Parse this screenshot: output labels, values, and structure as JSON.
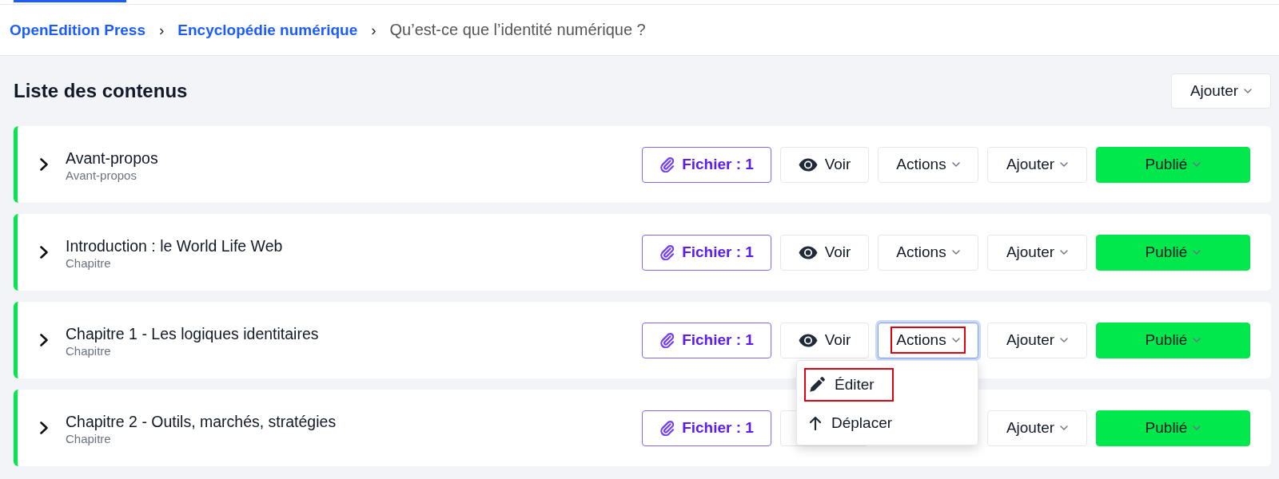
{
  "top_nav": {
    "tabs": [
      {
        "selected": true
      }
    ]
  },
  "breadcrumb": [
    {
      "kind": "link",
      "label": "OpenEdition Press"
    },
    {
      "kind": "separator",
      "label": "›"
    },
    {
      "kind": "link",
      "label": "Encyclopédie numérique"
    },
    {
      "kind": "separator",
      "label": "›"
    },
    {
      "kind": "current",
      "label": "Qu’est-ce que l’identité numérique ?"
    }
  ],
  "header": {
    "title": "Liste des contenus",
    "add_button": {
      "label": "Ajouter",
      "open": false
    }
  },
  "rows": [
    {
      "title": "Avant-propos",
      "subtitle": "Avant-propos",
      "expanded": false,
      "buttons": [
        {
          "kind": "file",
          "label": "Fichier : 1",
          "highlighted": false
        },
        {
          "kind": "view",
          "label": "Voir",
          "highlighted": false
        },
        {
          "kind": "actions",
          "label": "Actions",
          "open": false,
          "highlighted": false
        },
        {
          "kind": "add",
          "label": "Ajouter",
          "open": false,
          "highlighted": false
        },
        {
          "kind": "status",
          "label": "Publié",
          "open": false,
          "highlighted": false,
          "color": "#00e84c"
        }
      ]
    },
    {
      "title": "Introduction : le World Life Web",
      "subtitle": "Chapitre",
      "expanded": false,
      "buttons": [
        {
          "kind": "file",
          "label": "Fichier : 1",
          "highlighted": false
        },
        {
          "kind": "view",
          "label": "Voir",
          "highlighted": false
        },
        {
          "kind": "actions",
          "label": "Actions",
          "open": false,
          "highlighted": false
        },
        {
          "kind": "add",
          "label": "Ajouter",
          "open": false,
          "highlighted": false
        },
        {
          "kind": "status",
          "label": "Publié",
          "open": false,
          "highlighted": false,
          "color": "#00e84c"
        }
      ]
    },
    {
      "title": "Chapitre 1 - Les logiques identitaires",
      "subtitle": "Chapitre",
      "expanded": false,
      "buttons": [
        {
          "kind": "file",
          "label": "Fichier : 1",
          "highlighted": false
        },
        {
          "kind": "view",
          "label": "Voir",
          "highlighted": false
        },
        {
          "kind": "actions",
          "label": "Actions",
          "open": true,
          "highlighted": true,
          "menu": [
            {
              "kind": "edit",
              "label": "Éditer",
              "highlighted": true
            },
            {
              "kind": "move",
              "label": "Déplacer",
              "highlighted": false
            }
          ]
        },
        {
          "kind": "add",
          "label": "Ajouter",
          "open": false,
          "highlighted": false
        },
        {
          "kind": "status",
          "label": "Publié",
          "open": false,
          "highlighted": false,
          "color": "#00e84c"
        }
      ]
    },
    {
      "title": "Chapitre 2 - Outils, marchés, stratégies",
      "subtitle": "Chapitre",
      "expanded": false,
      "buttons": [
        {
          "kind": "file",
          "label": "Fichier : 1",
          "highlighted": false
        },
        {
          "kind": "view"
        },
        {
          "kind": "add",
          "label": "Ajouter",
          "open": false,
          "highlighted": false
        },
        {
          "kind": "status",
          "label": "Publié",
          "open": false,
          "highlighted": false,
          "color": "#00e84c"
        }
      ]
    }
  ]
}
